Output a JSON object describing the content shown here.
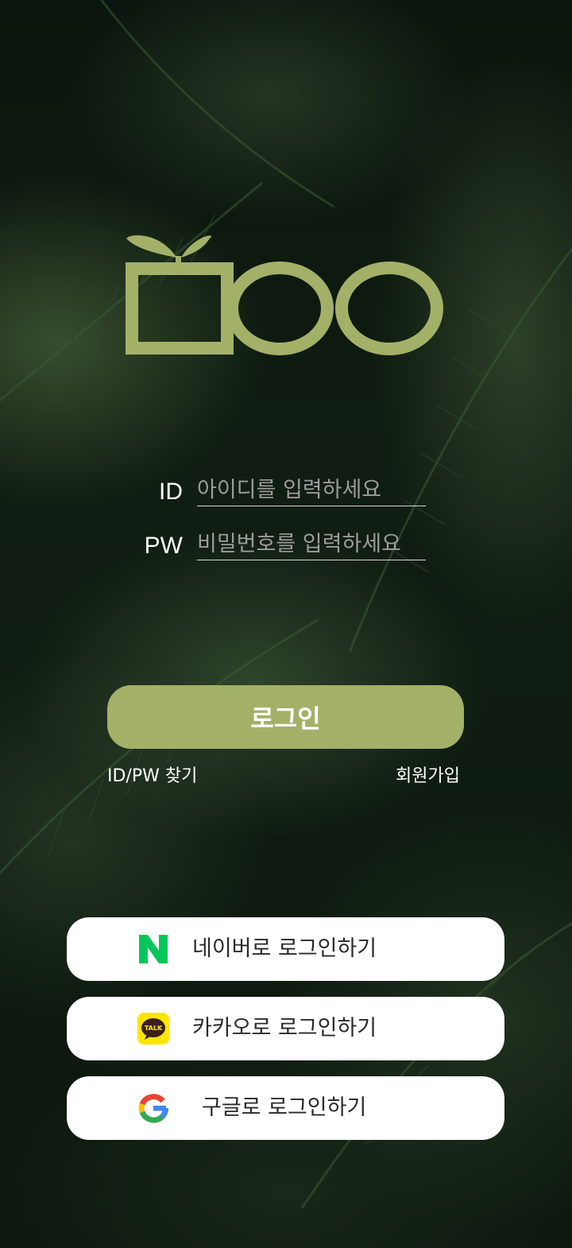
{
  "login_form": {
    "id_label": "ID",
    "id_placeholder": "아이디를 입력하세요",
    "pw_label": "PW",
    "pw_placeholder": "비밀번호를 입력하세요",
    "login_button": "로그인",
    "find_id_pw": "ID/PW 찾기",
    "signup": "회원가입"
  },
  "social_login": [
    {
      "label": "네이버로 로그인하기",
      "icon": "naver-icon"
    },
    {
      "label": "카카오로 로그인하기",
      "icon": "kakao-talk-icon"
    },
    {
      "label": "구글로 로그인하기",
      "icon": "google-icon"
    }
  ],
  "kakao_icon_text": "TALK",
  "colors": {
    "accent": "#a3b168",
    "naver_green": "#03c75a",
    "kakao_yellow": "#fee500",
    "background": "#0a140c"
  }
}
